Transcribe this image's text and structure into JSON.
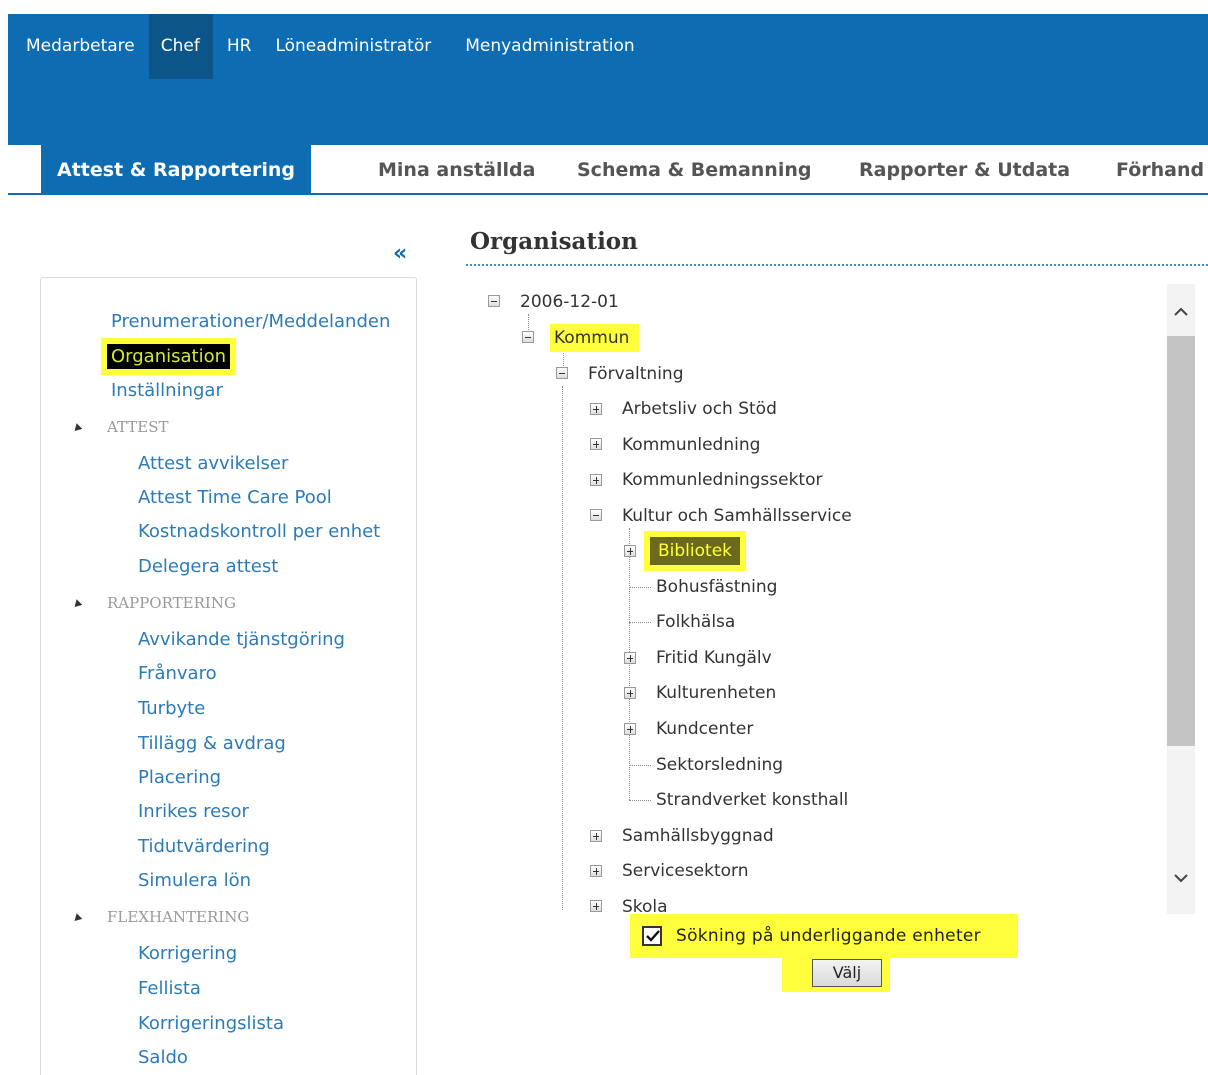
{
  "topnav": {
    "items": [
      "Medarbetare",
      "Chef",
      "HR",
      "Löneadministratör",
      "Menyadministration"
    ],
    "active": "Chef"
  },
  "tabs": [
    "Attest & Rapportering",
    "Mina anställda",
    "Schema & Bemanning",
    "Rapporter & Utdata",
    "Förhand"
  ],
  "leftnav": {
    "collapse_label": "«",
    "links": [
      "Prenumerationer/Meddelanden",
      "Organisation",
      "Inställningar"
    ],
    "sections": [
      {
        "title": "ATTEST",
        "items": [
          "Attest avvikelser",
          "Attest Time Care Pool",
          "Kostnadskontroll per enhet",
          "Delegera attest"
        ]
      },
      {
        "title": "RAPPORTERING",
        "items": [
          "Avvikande tjänstgöring",
          "Frånvaro",
          "Turbyte",
          "Tillägg & avdrag",
          "Placering",
          "Inrikes resor",
          "Tidutvärdering",
          "Simulera lön"
        ]
      },
      {
        "title": "FLEXHANTERING",
        "items": [
          "Korrigering",
          "Fellista",
          "Korrigeringslista",
          "Saldo"
        ]
      }
    ]
  },
  "content": {
    "title": "Organisation",
    "tree": {
      "root": "2006-12-01",
      "kommun": "Kommun",
      "forvaltning": "Förvaltning",
      "level3": [
        "Arbetsliv och Stöd",
        "Kommunledning",
        "Kommunledningssektor",
        "Kultur och Samhällsservice"
      ],
      "kultur_children": [
        "Bibliotek",
        "Bohusfästning",
        "Folkhälsa",
        "Fritid Kungälv",
        "Kulturenheten",
        "Kundcenter",
        "Sektorsledning",
        "Strandverket konsthall"
      ],
      "level3_after": [
        "Samhällsbyggnad",
        "Servicesektorn",
        "Skola"
      ]
    },
    "checkbox_label": "Sökning på underliggande enheter",
    "checkbox_checked": true,
    "select_button": "Välj"
  },
  "colors": {
    "brand_blue": "#0e6cb2",
    "highlight_yellow": "#ffff3b",
    "link_blue": "#2b7bb9"
  }
}
